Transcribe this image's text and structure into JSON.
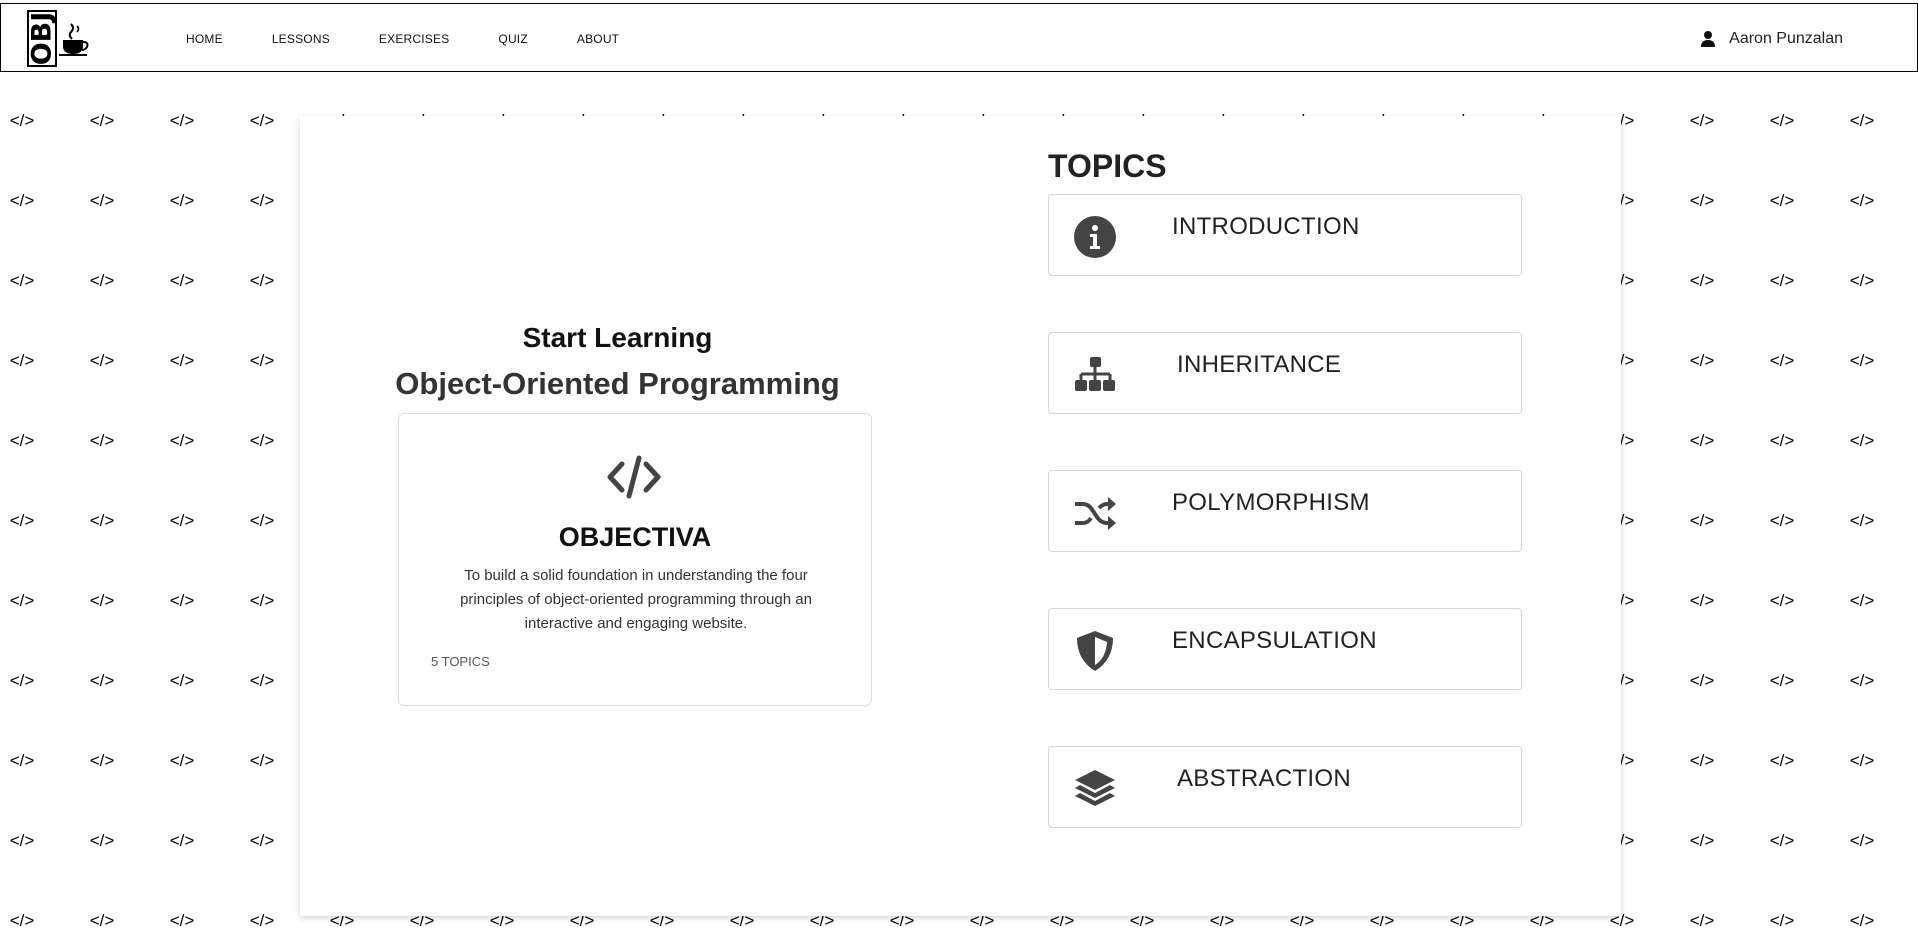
{
  "header": {
    "logo_text": "OBJ",
    "nav": [
      {
        "label": "HOME"
      },
      {
        "label": "LESSONS"
      },
      {
        "label": "EXERCISES"
      },
      {
        "label": "QUIZ"
      },
      {
        "label": "ABOUT"
      }
    ],
    "user_name": "Aaron Punzalan"
  },
  "background": {
    "pattern_glyph": "</>"
  },
  "main": {
    "start_title": "Start Learning",
    "subtitle": "Object-Oriented Programming",
    "card": {
      "icon": "code-icon",
      "name": "OBJECTIVA",
      "description": "To build a solid foundation in understanding the four principles of object-oriented programming through an interactive and engaging website.",
      "topic_count": "5 TOPICS"
    },
    "topics_heading": "TOPICS",
    "topics": [
      {
        "label": "INTRODUCTION",
        "icon": "info-icon"
      },
      {
        "label": "INHERITANCE",
        "icon": "hierarchy-icon"
      },
      {
        "label": "POLYMORPHISM",
        "icon": "shuffle-icon"
      },
      {
        "label": "ENCAPSULATION",
        "icon": "shield-icon"
      },
      {
        "label": "ABSTRACTION",
        "icon": "layers-icon"
      }
    ]
  },
  "colors": {
    "icon": "#444444",
    "border": "#000000",
    "text": "#222222"
  }
}
